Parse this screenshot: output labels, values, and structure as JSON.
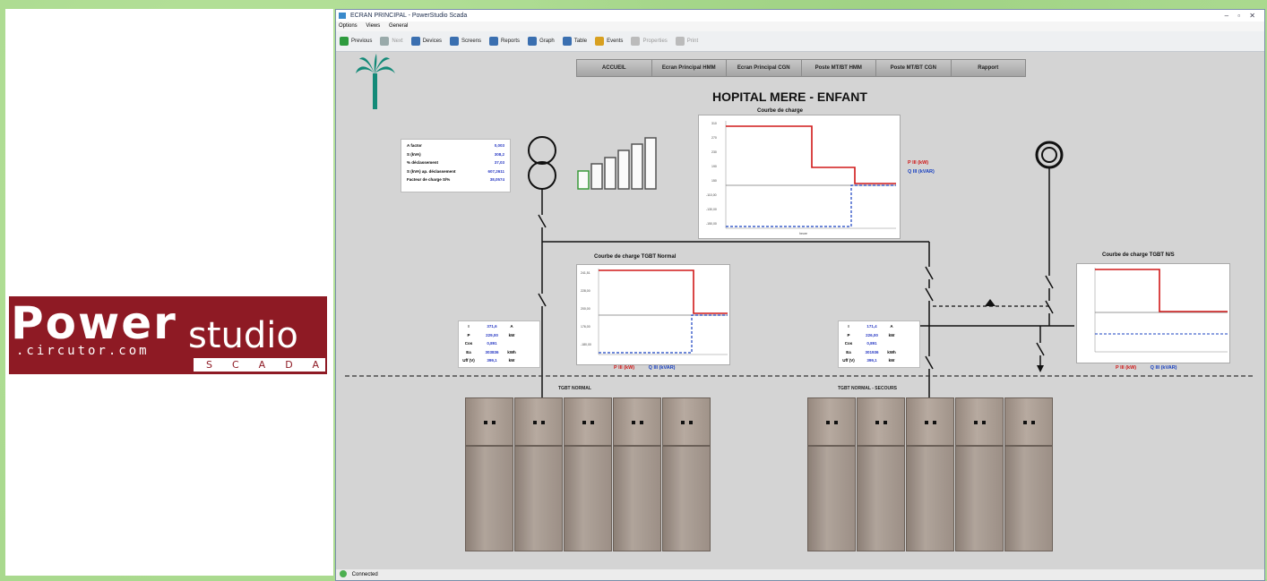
{
  "brand": {
    "power": "Power",
    "studio": "studio",
    "url": ".circutor.com",
    "scada": "SCADA"
  },
  "window": {
    "title": "ECRAN PRINCIPAL - PowerStudio Scada",
    "menu": [
      "Options",
      "Views",
      "General"
    ],
    "toolbar": [
      {
        "label": "Previous",
        "icon": "back-arrow-icon",
        "enabled": true
      },
      {
        "label": "Next",
        "icon": "forward-arrow-icon",
        "enabled": false
      },
      {
        "label": "Devices",
        "icon": "devices-icon",
        "enabled": true
      },
      {
        "label": "Screens",
        "icon": "screens-icon",
        "enabled": true
      },
      {
        "label": "Reports",
        "icon": "reports-icon",
        "enabled": true
      },
      {
        "label": "Graph",
        "icon": "graph-icon",
        "enabled": true
      },
      {
        "label": "Table",
        "icon": "table-icon",
        "enabled": true
      },
      {
        "label": "Events",
        "icon": "events-icon",
        "enabled": true
      },
      {
        "label": "Properties",
        "icon": "properties-icon",
        "enabled": false
      },
      {
        "label": "Print",
        "icon": "print-icon",
        "enabled": false
      }
    ],
    "status": "Connected"
  },
  "nav": [
    "ACCUEIL",
    "Ecran Principal HMM",
    "Ecran Principal CGN",
    "Poste MT/BT HMM",
    "Poste MT/BT CGN",
    "Rapport"
  ],
  "page_title": "HOPITAL MERE - ENFANT",
  "transformer_info": [
    {
      "label": "A factor",
      "value": "0,003"
    },
    {
      "label": "S (kVA)",
      "value": "308,2"
    },
    {
      "label": "% déclassement",
      "value": "37,03"
    },
    {
      "label": "S (kVA) ap. déclassement",
      "value": "607,2611"
    },
    {
      "label": "Facteur de charge S/% ",
      "value": "38,0574"
    }
  ],
  "meter_left": [
    {
      "label": "I",
      "value": "371,6",
      "unit": "A"
    },
    {
      "label": "P",
      "value": "229,00",
      "unit": "kW"
    },
    {
      "label": "Cos",
      "value": "0,891",
      "unit": ""
    },
    {
      "label": "Ea",
      "value": "303836",
      "unit": "kWh"
    },
    {
      "label": "Uff (V)",
      "value": "399,1",
      "unit": "kW"
    }
  ],
  "meter_right": [
    {
      "label": "I",
      "value": "171,4",
      "unit": "A"
    },
    {
      "label": "P",
      "value": "226,00",
      "unit": "kW"
    },
    {
      "label": "Cos",
      "value": "0,891",
      "unit": ""
    },
    {
      "label": "Ea",
      "value": "301936",
      "unit": "kWh"
    },
    {
      "label": "Uff (V)",
      "value": "399,1",
      "unit": "kW"
    }
  ],
  "charts": {
    "main": {
      "title": "Courbe de charge",
      "legend_p": "P III (kW)",
      "legend_q": "Q III (kVAR)"
    },
    "normal": {
      "title": "Courbe de charge TGBT Normal",
      "legend_p": "P III (kW)",
      "legend_q": "Q III (kVAR)"
    },
    "ns": {
      "title": "Courbe de charge TGBT N/S",
      "legend_p": "P III (kW)",
      "legend_q": "Q III (kVAR)"
    }
  },
  "cabinets": {
    "left_label": "TGBT NORMAL",
    "right_label": "TGBT NORMAL - SECOURS"
  },
  "colors": {
    "p_line": "#d01818",
    "q_line": "#1840c0",
    "logo": "#8e1a24"
  }
}
